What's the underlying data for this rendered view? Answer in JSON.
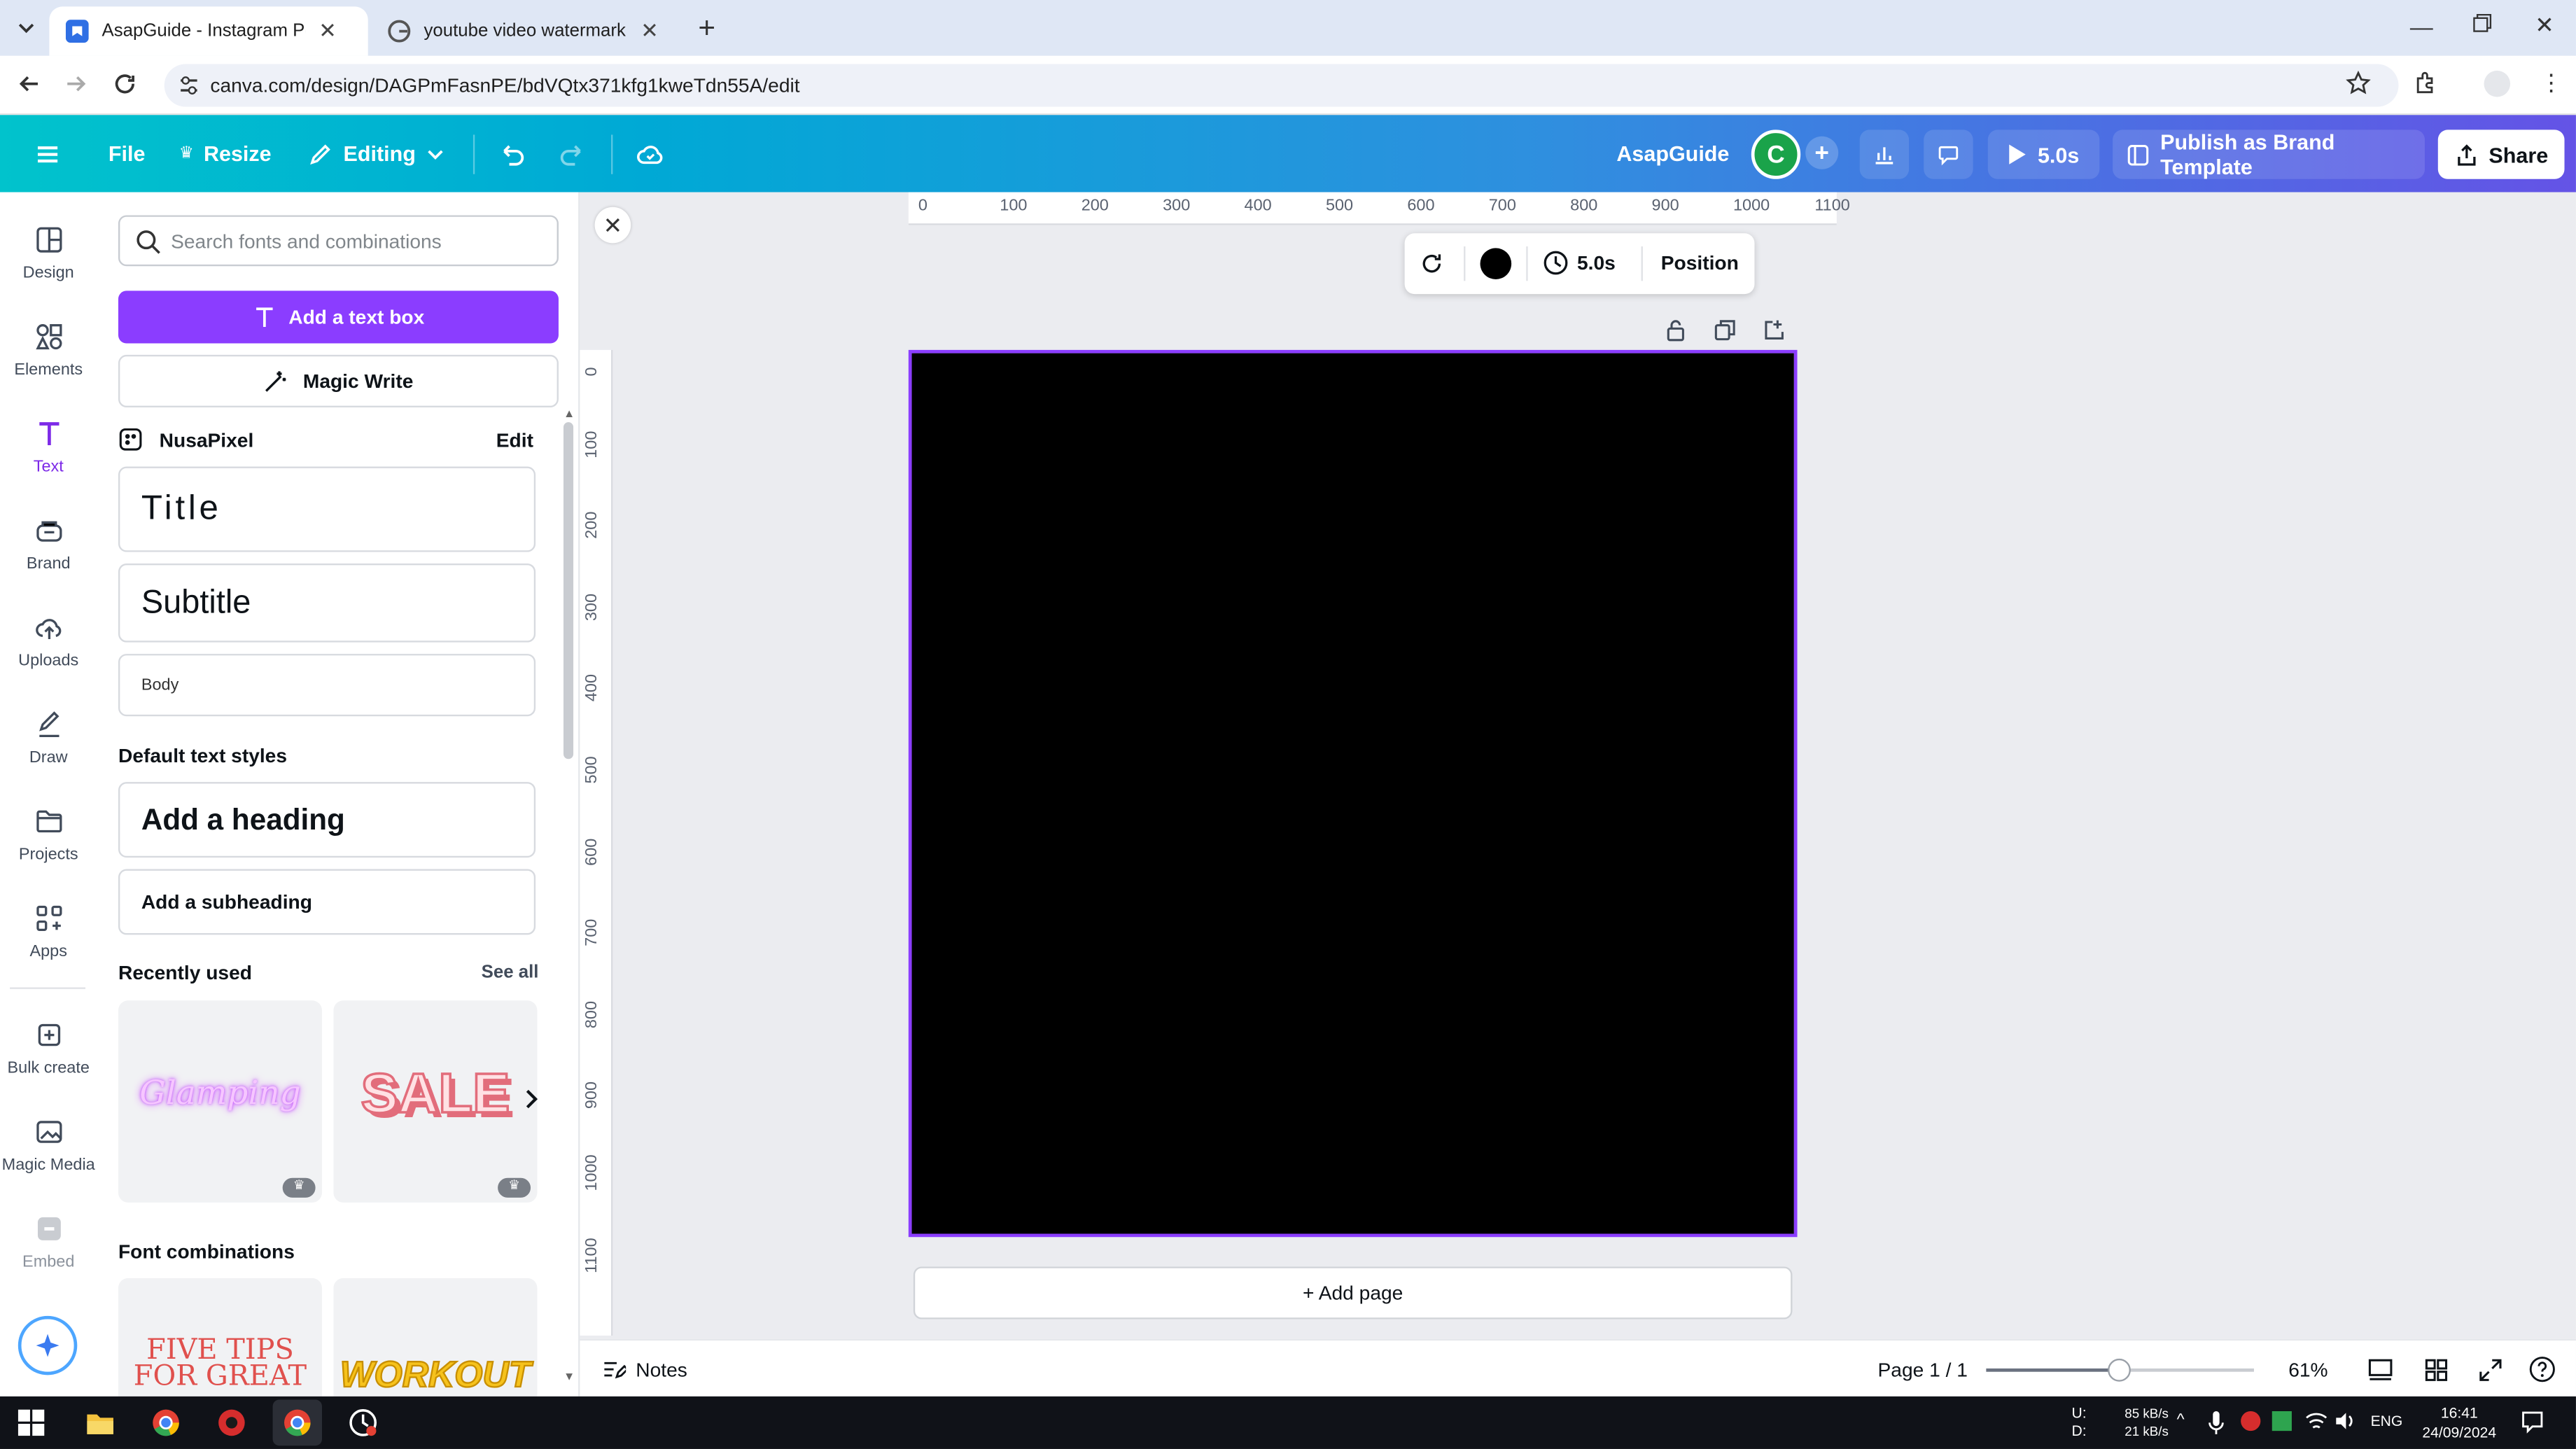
{
  "browser": {
    "tabs": [
      {
        "title": "AsapGuide - Instagram Post - C",
        "active": true
      },
      {
        "title": "youtube video watermark - Go",
        "active": false
      }
    ],
    "url": "canva.com/design/DAGPmFasnPE/bdVQtx371kfg1kweTdn55A/edit"
  },
  "toolbar": {
    "file": "File",
    "resize": "Resize",
    "editing": "Editing",
    "project_name": "AsapGuide",
    "avatar_initial": "C",
    "play_duration": "5.0s",
    "publish": "Publish as Brand Template",
    "share": "Share"
  },
  "rail": [
    {
      "label": "Design",
      "icon": "layout-icon"
    },
    {
      "label": "Elements",
      "icon": "shapes-icon"
    },
    {
      "label": "Text",
      "icon": "text-t-icon",
      "active": true
    },
    {
      "label": "Brand",
      "icon": "brand-icon"
    },
    {
      "label": "Uploads",
      "icon": "cloud-upload-icon"
    },
    {
      "label": "Draw",
      "icon": "pen-icon"
    },
    {
      "label": "Projects",
      "icon": "folder-icon"
    },
    {
      "label": "Apps",
      "icon": "apps-grid-icon"
    },
    {
      "label": "Bulk create",
      "icon": "bulk-create-icon"
    },
    {
      "label": "Magic Media",
      "icon": "magic-media-icon"
    },
    {
      "label": "Embed",
      "icon": "embed-icon"
    }
  ],
  "panel": {
    "search_placeholder": "Search fonts and combinations",
    "add_text_box": "Add a text box",
    "magic_write": "Magic Write",
    "brand_kit_name": "NusaPixel",
    "edit": "Edit",
    "brand_styles": {
      "title": "Title",
      "subtitle": "Subtitle",
      "body": "Body"
    },
    "default_styles_title": "Default text styles",
    "heading": "Add a heading",
    "subheading": "Add a subheading",
    "recently_used": "Recently used",
    "see_all": "See all",
    "recent_thumbs": [
      "Glamping",
      "SALE"
    ],
    "font_combinations": "Font combinations",
    "combo_thumbs": [
      "FIVE TIPS FOR GREAT",
      "WORKOUT"
    ]
  },
  "canvas": {
    "ruler_h": [
      "0",
      "100",
      "200",
      "300",
      "400",
      "500",
      "600",
      "700",
      "800",
      "900",
      "1000",
      "1100"
    ],
    "ruler_v": [
      "0",
      "100",
      "200",
      "300",
      "400",
      "500",
      "600",
      "700",
      "800",
      "900",
      "1000",
      "1100"
    ],
    "ctx_duration": "5.0s",
    "ctx_position": "Position",
    "page_color": "#000000",
    "add_page": "+ Add page"
  },
  "bottom": {
    "notes": "Notes",
    "page_indicator": "Page 1 / 1",
    "zoom": "61%",
    "zoom_level": 0.61
  },
  "taskbar": {
    "net_up_label": "U:",
    "net_down_label": "D:",
    "net_up": "85 kB/s",
    "net_down": "21 kB/s",
    "lang": "ENG",
    "time": "16:41",
    "date": "24/09/2024"
  },
  "colors": {
    "accent": "#8b3dff",
    "toolbar_start": "#01c3cc",
    "toolbar_end": "#6453e6"
  }
}
